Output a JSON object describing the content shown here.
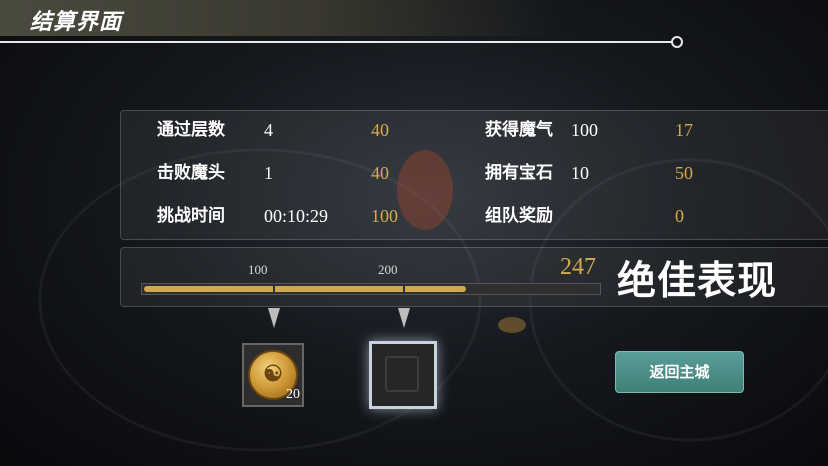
{
  "header": {
    "title": "结算界面"
  },
  "stats": {
    "left": [
      {
        "label": "通过层数",
        "value": "4",
        "score": "40"
      },
      {
        "label": "击败魔头",
        "value": "1",
        "score": "40"
      },
      {
        "label": "挑战时间",
        "value": "00:10:29",
        "score": "100"
      }
    ],
    "right": [
      {
        "label": "获得魔气",
        "value": "100",
        "score": "17"
      },
      {
        "label": "拥有宝石",
        "value": "10",
        "score": "50"
      },
      {
        "label": "组队奖励",
        "value": "",
        "score": "0"
      }
    ]
  },
  "score": {
    "ticks": [
      "100",
      "200"
    ],
    "total": "247",
    "rating": "绝佳表现",
    "progress_fraction": 0.71
  },
  "rewards": [
    {
      "count": "20",
      "icon": "gold-coin-icon",
      "state": "unlocked"
    },
    {
      "count": "",
      "icon": "locked-chest-icon",
      "state": "locked"
    }
  ],
  "actions": {
    "return_label": "返回主城"
  },
  "colors": {
    "accent_gold": "#d7a94f",
    "button_teal": "#4f8f88"
  }
}
